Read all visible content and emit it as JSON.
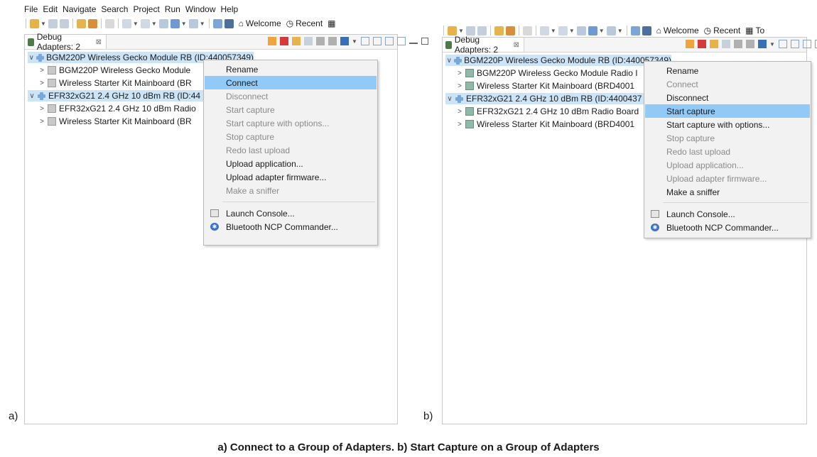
{
  "colors": {
    "selection": "#cce4f7",
    "menu_highlight": "#91c9f7",
    "menu_bg": "#f2f2f2",
    "disabled": "#8a8a8a"
  },
  "panel_a": {
    "sub_label": "a)",
    "menubar": [
      "File",
      "Edit",
      "Navigate",
      "Search",
      "Project",
      "Run",
      "Window",
      "Help"
    ],
    "toolbar": {
      "welcome": "Welcome",
      "recent": "Recent"
    },
    "view_tab": {
      "label": "Debug Adapters: 2",
      "close": "⊠"
    },
    "tree": [
      {
        "label": "BGM220P Wireless Gecko Module RB (ID:440057349)",
        "twist": "∨",
        "kind": "device",
        "selected": true
      },
      {
        "label": "BGM220P Wireless Gecko Module",
        "twist": ">",
        "kind": "board-gray"
      },
      {
        "label": "Wireless Starter Kit Mainboard (BR",
        "twist": ">",
        "kind": "board-gray"
      },
      {
        "label": "EFR32xG21 2.4 GHz 10 dBm RB (ID:44",
        "twist": "∨",
        "kind": "device",
        "selected": true
      },
      {
        "label": "EFR32xG21 2.4 GHz 10 dBm Radio",
        "twist": ">",
        "kind": "board-gray"
      },
      {
        "label": "Wireless Starter Kit Mainboard (BR",
        "twist": ">",
        "kind": "board-gray"
      }
    ],
    "context_menu": [
      {
        "label": "Rename",
        "enabled": true
      },
      {
        "label": "Connect",
        "enabled": true,
        "highlighted": true
      },
      {
        "label": "Disconnect",
        "enabled": false
      },
      {
        "label": "Start capture",
        "enabled": false
      },
      {
        "label": "Start capture with options...",
        "enabled": false
      },
      {
        "label": "Stop capture",
        "enabled": false
      },
      {
        "label": "Redo last upload",
        "enabled": false
      },
      {
        "label": "Upload application...",
        "enabled": true
      },
      {
        "label": "Upload adapter firmware...",
        "enabled": true
      },
      {
        "label": "Make a sniffer",
        "enabled": false
      },
      {
        "label": "Launch Console...",
        "enabled": true,
        "icon": "console-icon"
      },
      {
        "label": "Bluetooth NCP Commander...",
        "enabled": true,
        "icon": "bluetooth-icon"
      }
    ]
  },
  "panel_b": {
    "sub_label": "b)",
    "toolbar": {
      "welcome": "Welcome",
      "recent": "Recent",
      "tools": "To"
    },
    "view_tab": {
      "label": "Debug Adapters: 2",
      "close": "⊠"
    },
    "tree": [
      {
        "label": "BGM220P Wireless Gecko Module RB (ID:440057349)",
        "twist": "∨",
        "kind": "device",
        "selected": true
      },
      {
        "label": "BGM220P Wireless Gecko Module Radio I",
        "twist": ">",
        "kind": "board"
      },
      {
        "label": "Wireless Starter Kit Mainboard (BRD4001",
        "twist": ">",
        "kind": "board"
      },
      {
        "label": "EFR32xG21 2.4 GHz 10 dBm RB (ID:4400437",
        "twist": "∨",
        "kind": "device",
        "selected": true
      },
      {
        "label": "EFR32xG21 2.4 GHz 10 dBm Radio Board",
        "twist": ">",
        "kind": "board"
      },
      {
        "label": "Wireless Starter Kit Mainboard (BRD4001",
        "twist": ">",
        "kind": "board"
      }
    ],
    "context_menu": [
      {
        "label": "Rename",
        "enabled": true
      },
      {
        "label": "Connect",
        "enabled": false
      },
      {
        "label": "Disconnect",
        "enabled": true
      },
      {
        "label": "Start capture",
        "enabled": true,
        "highlighted": true
      },
      {
        "label": "Start capture with options...",
        "enabled": true
      },
      {
        "label": "Stop capture",
        "enabled": false
      },
      {
        "label": "Redo last upload",
        "enabled": false
      },
      {
        "label": "Upload application...",
        "enabled": false
      },
      {
        "label": "Upload adapter firmware...",
        "enabled": false
      },
      {
        "label": "Make a sniffer",
        "enabled": true
      },
      {
        "label": "Launch Console...",
        "enabled": true,
        "icon": "console-icon"
      },
      {
        "label": "Bluetooth NCP Commander...",
        "enabled": true,
        "icon": "bluetooth-icon"
      }
    ]
  },
  "caption": "a) Connect to a Group of Adapters. b) Start Capture on a Group of Adapters"
}
